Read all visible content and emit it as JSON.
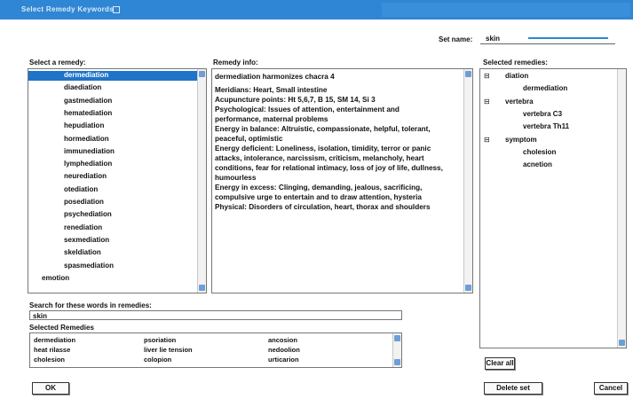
{
  "window": {
    "title": "Select Remedy Keywords"
  },
  "set_name": {
    "label": "Set name:",
    "value": "skin"
  },
  "remedy_list": {
    "header": "Select a remedy:",
    "items": [
      "dermediation",
      "diaediation",
      "gastmediation",
      "hematediation",
      "hepudiation",
      "hormediation",
      "immunediation",
      "lymphediation",
      "neurediation",
      "otediation",
      "posediation",
      "psychediation",
      "renediation",
      "sexmediation",
      "skeldiation",
      "spasmediation",
      "emotion"
    ],
    "selected_index": 0
  },
  "remedy_info": {
    "header": "Remedy info:",
    "lines": [
      "dermediation harmonizes chacra 4",
      "",
      "Meridians: Heart, Small intestine",
      "Acupuncture points: Ht 5,6,7, B 15, SM 14, Si 3",
      "Psychological: Issues of attention, entertainment and",
      "performance, maternal problems",
      "Energy in balance: Altruistic, compassionate, helpful, tolerant,",
      "peaceful, optimistic",
      "Energy deficient: Loneliness, isolation, timidity, terror or panic",
      "attacks, intolerance, narcissism, criticism, melancholy, heart",
      "conditions, fear for relational intimacy, loss of joy of life, dullness,",
      "humourless",
      "Energy in excess: Clinging, demanding, jealous, sacrificing,",
      "compulsive urge to entertain and to draw attention, hysteria",
      "Physical: Disorders of circulation, heart, thorax and shoulders"
    ]
  },
  "selected_remedies": {
    "header": "Selected remedies:",
    "tree": [
      {
        "label": "diation",
        "level": 0,
        "toggle": "⊟"
      },
      {
        "label": "dermediation",
        "level": 1,
        "toggle": ""
      },
      {
        "label": "vertebra",
        "level": 0,
        "toggle": "⊟"
      },
      {
        "label": "vertebra C3",
        "level": 1,
        "toggle": ""
      },
      {
        "label": "vertebra Th11",
        "level": 1,
        "toggle": ""
      },
      {
        "label": "symptom",
        "level": 0,
        "toggle": "⊟"
      },
      {
        "label": "cholesion",
        "level": 1,
        "toggle": ""
      },
      {
        "label": "acnetion",
        "level": 1,
        "toggle": ""
      }
    ],
    "clear_all": "Clear all"
  },
  "search": {
    "label": "Search for these words in remedies:",
    "value": "skin",
    "results_label": "Selected Remedies",
    "rows": [
      [
        "dermediation",
        "psoriation",
        "ancosion"
      ],
      [
        "heat rilasse",
        "liver lie tension",
        "nedoolion"
      ],
      [
        "cholesion",
        "colopion",
        "urticarion"
      ]
    ]
  },
  "buttons": {
    "ok": "OK",
    "delete_set": "Delete set",
    "cancel": "Cancel"
  }
}
